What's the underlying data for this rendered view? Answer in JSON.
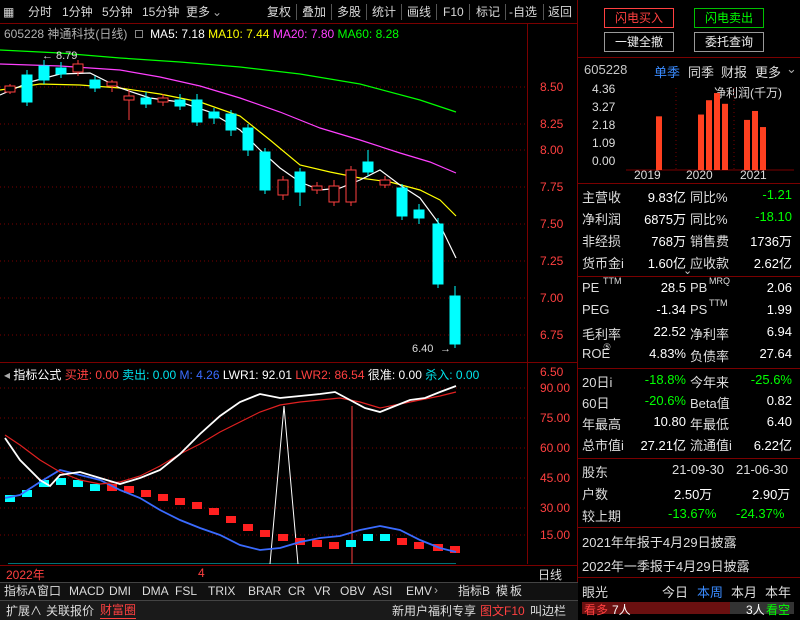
{
  "toolbar": {
    "b1": "分时",
    "b2": "1分钟",
    "b3": "5分钟",
    "b4": "15分钟",
    "b5": "更多",
    "r1": "复权",
    "r2": "叠加",
    "r3": "多股",
    "r4": "统计",
    "r5": "画线",
    "r6": "F10",
    "r7": "标记",
    "r8": "-自选",
    "r9": "返回"
  },
  "header": {
    "stock": "605228 神通科技(日线)",
    "ma5": "MA5: 7.18",
    "ma10": "MA10: 7.44",
    "ma20": "MA20: 7.80",
    "ma60": "MA60: 8.28"
  },
  "main_chart": {
    "yticks": [
      "8.50",
      "8.25",
      "8.00",
      "7.75",
      "7.50",
      "7.25",
      "7.00",
      "6.75",
      "6.50"
    ],
    "high_label": "8.79",
    "low_label": "6.40"
  },
  "indicator": {
    "name": "指标公式",
    "buy": "买进: 0.00",
    "sell": "卖出: 0.00",
    "m": "M: 4.26",
    "lwr1": "LWR1: 92.01",
    "lwr2": "LWR2: 86.54",
    "hen": "很准: 0.00",
    "sha": "杀入: 0.00",
    "yticks": [
      "90.00",
      "75.00",
      "60.00",
      "45.00",
      "30.00",
      "15.00"
    ]
  },
  "date_axis": {
    "year": "2022年",
    "month": "4",
    "period": "日线"
  },
  "index_tabs": [
    "指标A",
    "窗口",
    "MACD",
    "DMI",
    "DMA",
    "FSL",
    "TRIX",
    "BRAR",
    "CR",
    "VR",
    "OBV",
    "ASI",
    "EMV"
  ],
  "index_tabs_right": [
    "指标B",
    "模",
    "板"
  ],
  "bottom_bar": {
    "b1": "扩展∧",
    "b2": "关联报价",
    "b3": "财富圈",
    "promo": "新用户福利专享",
    "b4": "图文F10",
    "b5": "叫边栏"
  },
  "right": {
    "flash_buy": "闪电买入",
    "flash_sell": "闪电卖出",
    "cancel_all": "一键全撤",
    "query": "委托查询",
    "code": "605228",
    "tabs": [
      "单季",
      "同季",
      "财报",
      "更多"
    ],
    "bar_yticks": [
      "4.36",
      "3.27",
      "2.18",
      "1.09",
      "0.00"
    ],
    "bar_title": "净利润(千万)",
    "bar_years": [
      "2019",
      "2020",
      "2021"
    ],
    "bar_values": [
      3.0,
      0,
      0,
      3.1,
      3.9,
      4.3,
      3.7,
      0,
      0,
      2.8,
      3.3,
      2.4
    ],
    "fin": [
      [
        "主营收",
        "9.83亿",
        "同比%",
        "-1.21"
      ],
      [
        "净利润",
        "6875万",
        "同比%",
        "-18.10"
      ],
      [
        "非经损",
        "768万",
        "销售费",
        "1736万"
      ],
      [
        "货币金i",
        "1.60亿",
        "应收款",
        "2.62亿"
      ]
    ],
    "val": [
      [
        "PE",
        "TTM",
        "28.5",
        "PB",
        "MRQ",
        "2.06"
      ],
      [
        "PEG",
        "",
        "-1.34",
        "PS",
        "TTM",
        "1.99"
      ],
      [
        "毛利率",
        "",
        "22.52",
        "净利率",
        "",
        "6.94"
      ],
      [
        "ROE",
        "⑤",
        "4.83%",
        "负债率",
        "",
        "27.64"
      ]
    ],
    "perf": [
      [
        "20日i",
        "-18.8%",
        "今年来",
        "-25.6%"
      ],
      [
        "60日",
        "-20.6%",
        "Beta值",
        "0.82"
      ],
      [
        "年最高",
        "10.80",
        "年最低",
        "6.40"
      ],
      [
        "总市值i",
        "27.21亿",
        "流通值i",
        "6.22亿"
      ]
    ],
    "holders": {
      "h0": "股东",
      "d1": "21-09-30",
      "d2": "21-06-30",
      "r1": "户数",
      "a1": "2.50万",
      "a2": "2.90万",
      "r2": "较上期",
      "c1": "-13.67%",
      "c2": "-24.37%"
    },
    "notes": [
      "2021年年报于4月29日披露",
      "2022年一季报于4月29日披露"
    ],
    "eye": {
      "label": "眼光",
      "t1": "今日",
      "t2": "本周",
      "t3": "本月",
      "t4": "本年",
      "look": "看多",
      "lookn": "7人",
      "lookk": "看空",
      "lookkn": "3人"
    }
  }
}
